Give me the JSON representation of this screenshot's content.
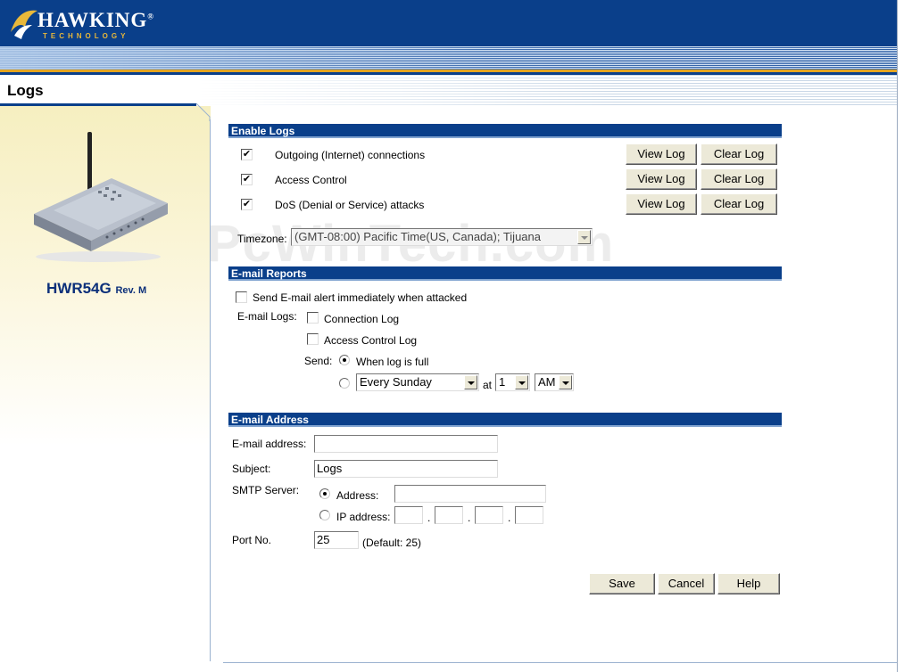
{
  "brand": {
    "name": "HAWKING",
    "tagline": "TECHNOLOGY",
    "registered": "®"
  },
  "page_title": "Logs",
  "model": {
    "name": "HWR54G",
    "rev": "Rev. M"
  },
  "watermark": "PcWinTech.com",
  "enable_logs": {
    "header": "Enable Logs",
    "rows": [
      {
        "label": "Outgoing (Internet) connections",
        "checked": true,
        "view": "View Log",
        "clear": "Clear Log"
      },
      {
        "label": "Access Control",
        "checked": true,
        "view": "View Log",
        "clear": "Clear Log"
      },
      {
        "label": "DoS (Denial or Service) attacks",
        "checked": true,
        "view": "View Log",
        "clear": "Clear Log"
      }
    ],
    "timezone_label": "Timezone:",
    "timezone_value": "(GMT-08:00) Pacific Time(US, Canada); Tijuana"
  },
  "email_reports": {
    "header": "E-mail Reports",
    "alert_label": "Send E-mail alert immediately when attacked",
    "alert_checked": false,
    "email_logs_label": "E-mail Logs:",
    "connection_log": "Connection Log",
    "connection_log_checked": false,
    "access_control_log": "Access Control Log",
    "access_control_log_checked": false,
    "send_label": "Send:",
    "when_full": "When log is full",
    "when_full_selected": true,
    "schedule_day": "Every Sunday",
    "at_label": "at",
    "schedule_hour": "1",
    "schedule_ampm": "AM"
  },
  "email_address": {
    "header": "E-mail Address",
    "address_label": "E-mail address:",
    "address_value": "",
    "subject_label": "Subject:",
    "subject_value": "Logs",
    "smtp_label": "SMTP Server:",
    "smtp_address_label": "Address:",
    "smtp_address_selected": true,
    "smtp_address_value": "",
    "smtp_ip_label": "IP address:",
    "ip_sep": ".",
    "port_label": "Port No.",
    "port_value": "25",
    "port_default": "(Default: 25)"
  },
  "actions": {
    "save": "Save",
    "cancel": "Cancel",
    "help": "Help"
  },
  "colors": {
    "header_blue": "#0a3f8a",
    "gold": "#e5a520",
    "model_blue": "#0b2f7a"
  }
}
